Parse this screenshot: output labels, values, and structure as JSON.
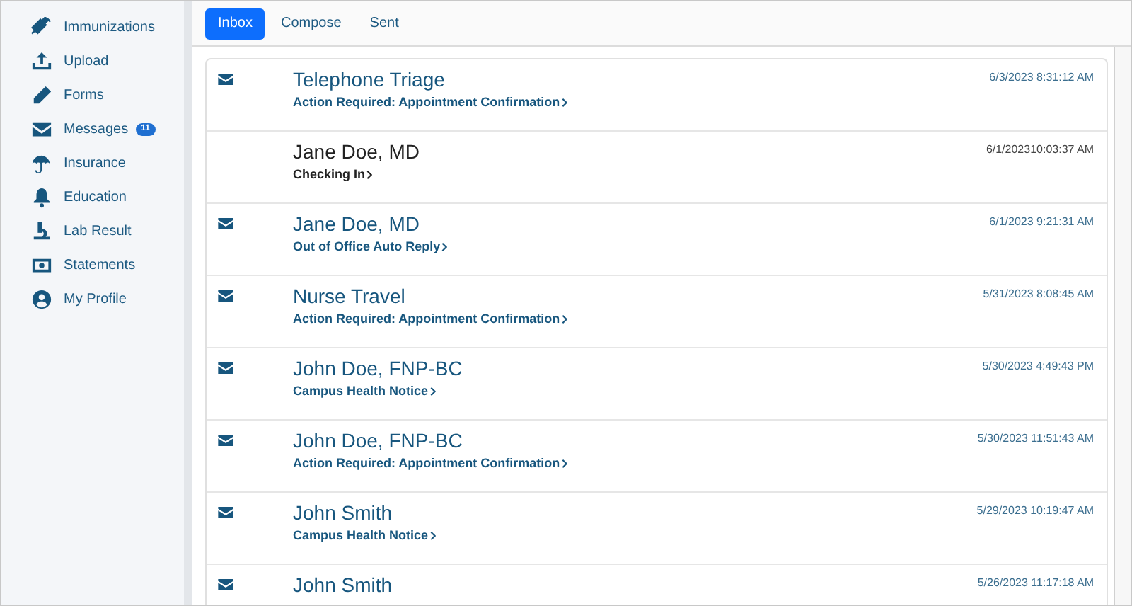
{
  "sidebar": {
    "items": [
      {
        "label": "Immunizations"
      },
      {
        "label": "Upload"
      },
      {
        "label": "Forms"
      },
      {
        "label": "Messages",
        "badge": "11"
      },
      {
        "label": "Insurance"
      },
      {
        "label": "Education"
      },
      {
        "label": "Lab Result"
      },
      {
        "label": "Statements"
      },
      {
        "label": "My Profile"
      }
    ]
  },
  "tabs": [
    {
      "label": "Inbox",
      "selected": true
    },
    {
      "label": "Compose",
      "selected": false
    },
    {
      "label": "Sent",
      "selected": false
    }
  ],
  "messages": [
    {
      "sender": "Telephone Triage",
      "subject": "Action Required: Appointment Confirmation",
      "date": "6/3/2023 8:31:12 AM",
      "unread": true
    },
    {
      "sender": "Jane Doe, MD",
      "subject": "Checking In",
      "date": "6/1/202310:03:37 AM",
      "unread": false
    },
    {
      "sender": "Jane Doe, MD",
      "subject": "Out of Office Auto Reply",
      "date": "6/1/2023 9:21:31 AM",
      "unread": true
    },
    {
      "sender": "Nurse Travel",
      "subject": "Action Required: Appointment Confirmation",
      "date": "5/31/2023 8:08:45 AM",
      "unread": true
    },
    {
      "sender": "John Doe, FNP-BC",
      "subject": "Campus Health Notice",
      "date": "5/30/2023 4:49:43 PM",
      "unread": true
    },
    {
      "sender": "John Doe, FNP-BC",
      "subject": "Action Required: Appointment Confirmation",
      "date": "5/30/2023 11:51:43 AM",
      "unread": true
    },
    {
      "sender": "John Smith",
      "subject": "Campus Health Notice",
      "date": "5/29/2023 10:19:47 AM",
      "unread": true
    },
    {
      "sender": "John Smith",
      "date": "5/26/2023 11:17:18 AM",
      "unread": true
    }
  ]
}
